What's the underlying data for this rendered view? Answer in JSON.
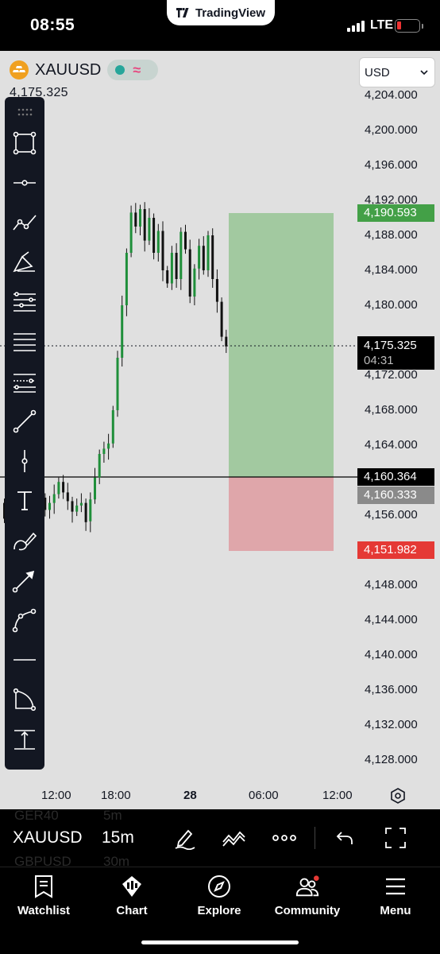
{
  "status_bar": {
    "time": "08:55",
    "app_pill": "TradingView",
    "carrier": "LTE"
  },
  "chart": {
    "symbol": "XAUUSD",
    "last_price": "4,175.325",
    "currency": "USD",
    "price_axis": [
      "4,204.000",
      "4,200.000",
      "4,196.000",
      "4,192.000",
      "4,188.000",
      "4,184.000",
      "4,180.000",
      "4,172.000",
      "4,168.000",
      "4,164.000",
      "4,156.000",
      "4,148.000",
      "4,144.000",
      "4,140.000",
      "4,136.000",
      "4,132.000",
      "4,128.000"
    ],
    "tags": {
      "target": "4,190.593",
      "current": "4,175.325",
      "countdown": "04:31",
      "entry": "4,160.364",
      "bid": "4,160.333",
      "stop": "4,151.982"
    },
    "time_axis": [
      "12:00",
      "18:00",
      "28",
      "06:00",
      "12:00"
    ],
    "colors": {
      "up": "#1f8f3a",
      "down": "#111111",
      "profit_zone": "#a2c9a0",
      "loss_zone": "#dfa6aa",
      "target_tag": "#43a047",
      "stop_tag": "#e53935",
      "bid_tag": "#8a8a8a"
    }
  },
  "toolbar": {
    "tools": [
      "rectangle-tool-icon",
      "horizontal-ray-icon",
      "trend-lines-icon",
      "brush-icon",
      "fib-retracement-icon",
      "parallel-channel-icon",
      "pitchfork-icon",
      "trend-line-icon",
      "vertical-line-icon",
      "text-icon",
      "brush-tool-icon",
      "arrow-icon",
      "curve-icon",
      "horizontal-line-icon",
      "arc-icon",
      "measure-icon"
    ]
  },
  "symbol_bar": {
    "symbol": "XAUUSD",
    "timeframe": "15m",
    "ghost_items": [
      {
        "symbol": "GER40",
        "tf": "5m"
      },
      {
        "symbol": "GBPUSD",
        "tf": "30m"
      }
    ]
  },
  "tab_bar": {
    "tabs": [
      {
        "label": "Watchlist",
        "icon": "watchlist-icon"
      },
      {
        "label": "Chart",
        "icon": "chart-icon"
      },
      {
        "label": "Explore",
        "icon": "compass-icon"
      },
      {
        "label": "Community",
        "icon": "community-icon"
      },
      {
        "label": "Menu",
        "icon": "menu-icon"
      }
    ]
  }
}
